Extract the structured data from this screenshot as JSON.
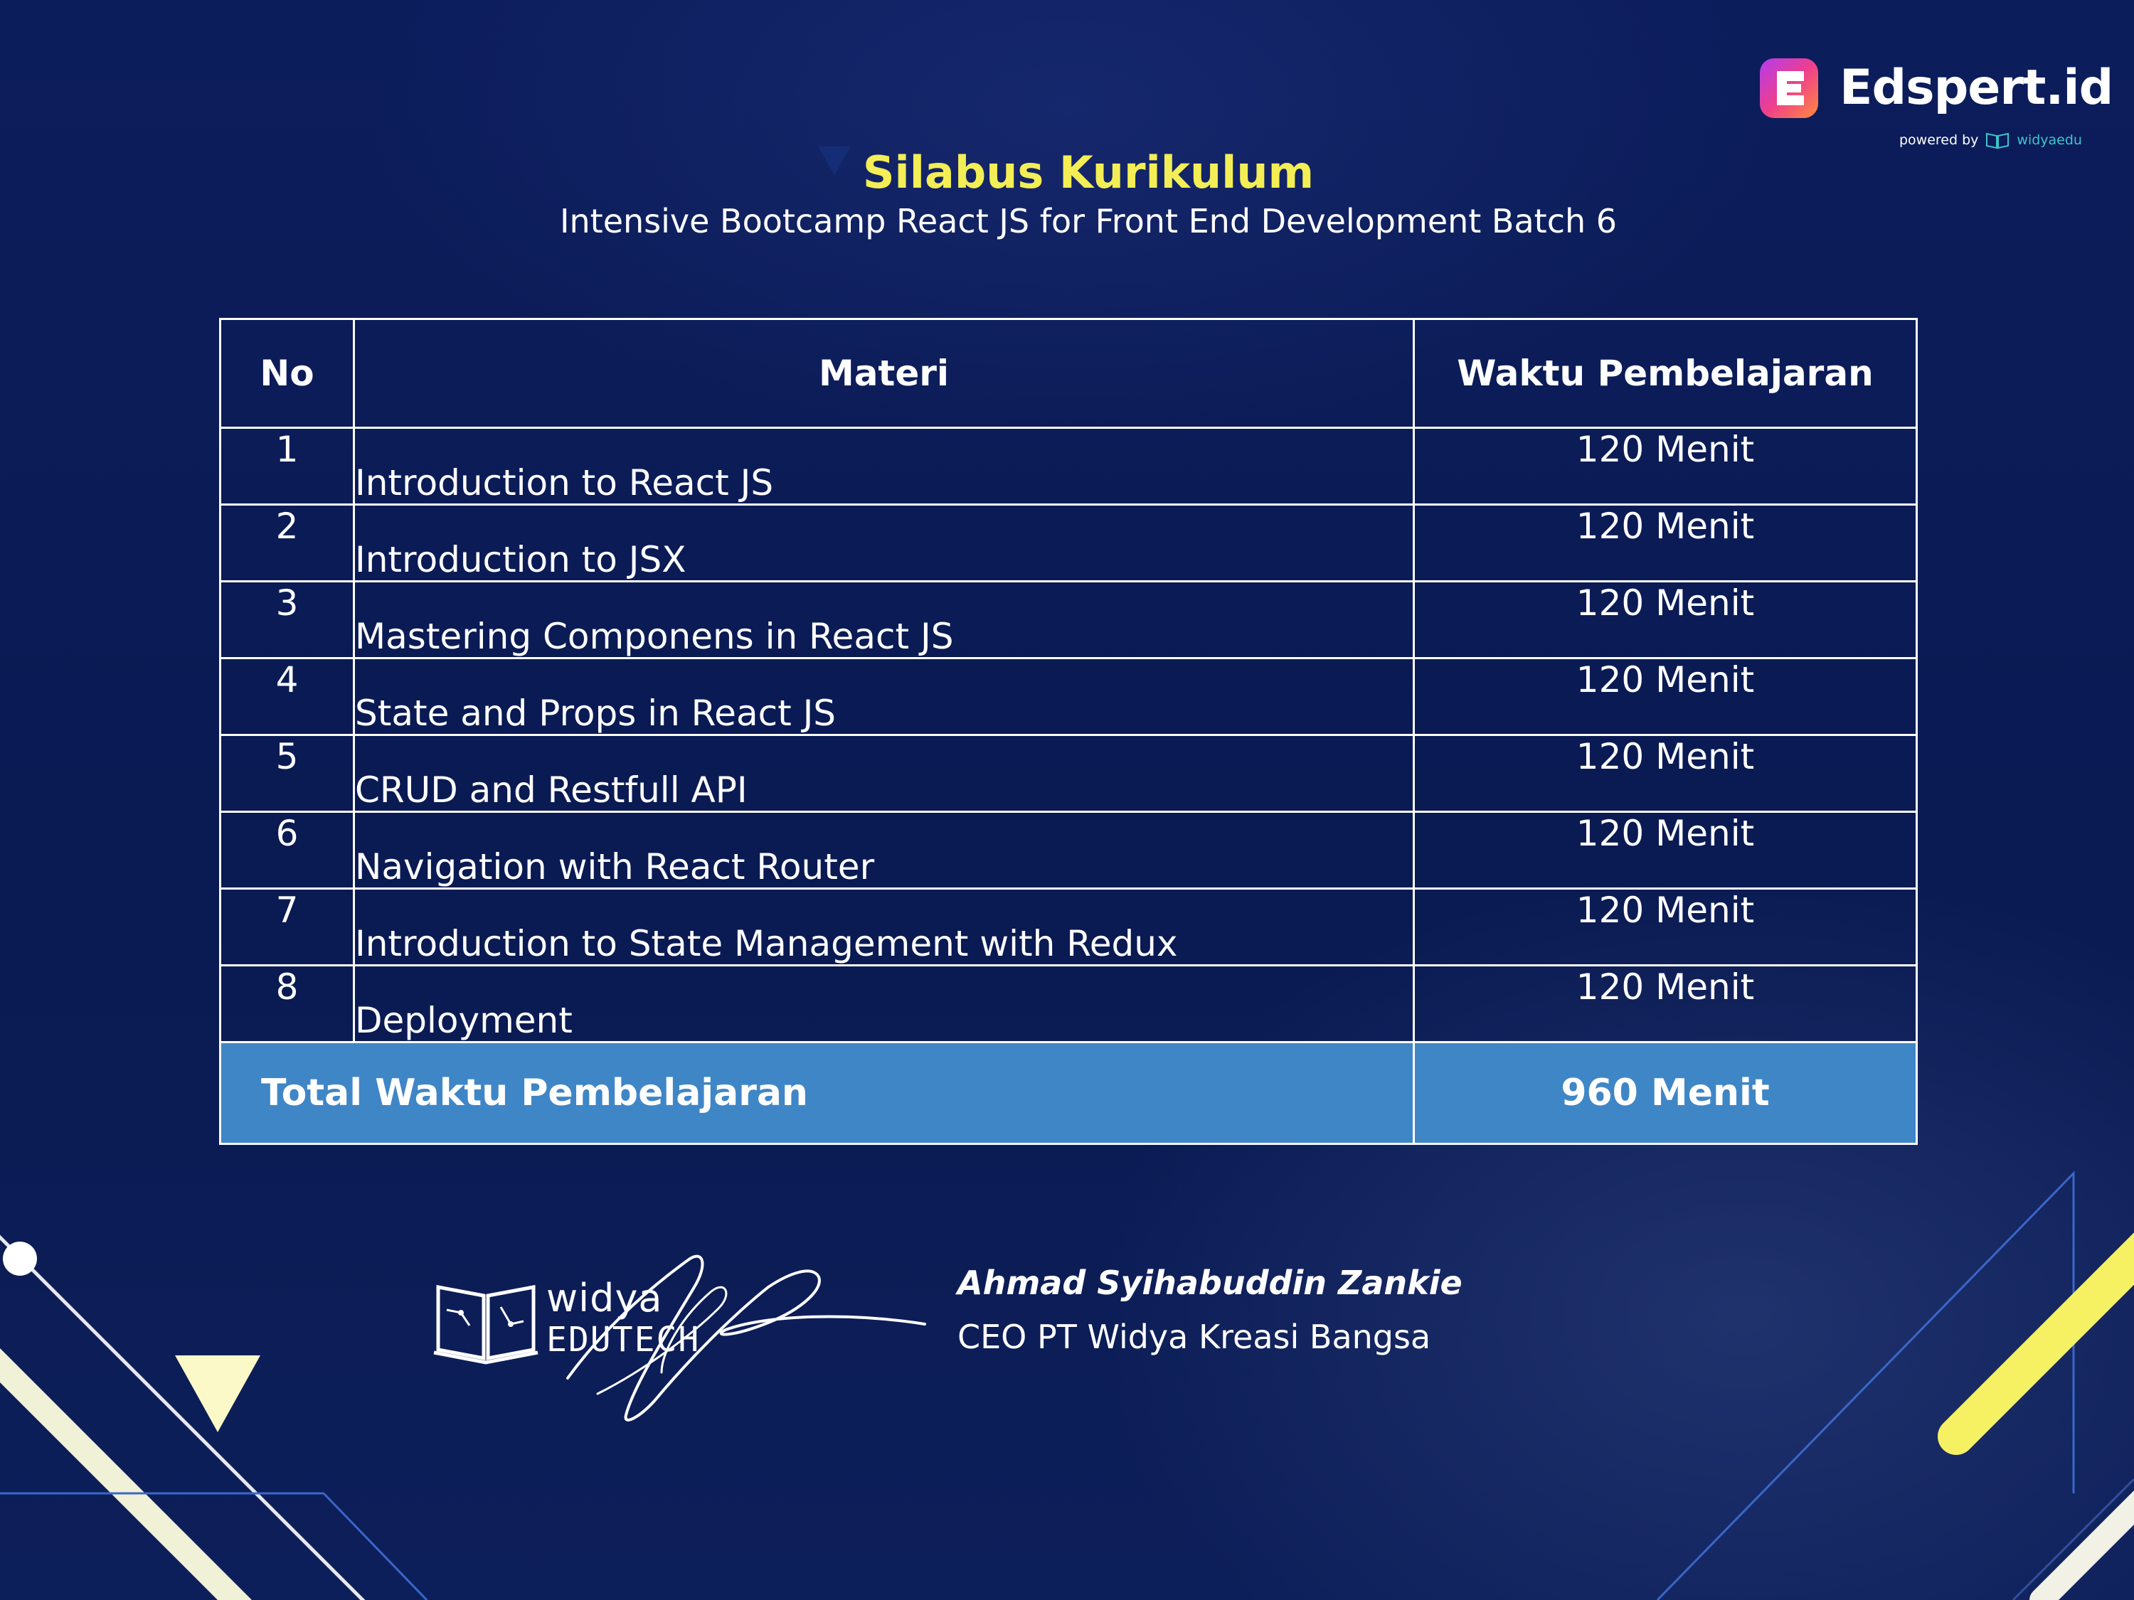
{
  "brand": {
    "name": "Edspert.id",
    "powered_by": "powered by",
    "partner": "widyaedu",
    "accent_yellow": "#f3ee55",
    "accent_blue": "#3f86c7",
    "background": "#0b1b58"
  },
  "header": {
    "title": "Silabus Kurikulum",
    "subtitle": "Intensive Bootcamp React JS for Front End Development Batch 6"
  },
  "table": {
    "columns": [
      "No",
      "Materi",
      "Waktu Pembelajaran"
    ],
    "rows": [
      {
        "no": "1",
        "materi": "Introduction to React JS",
        "waktu": "120 Menit"
      },
      {
        "no": "2",
        "materi": "Introduction to JSX",
        "waktu": "120 Menit"
      },
      {
        "no": "3",
        "materi": "Mastering Componens in React JS",
        "waktu": "120 Menit"
      },
      {
        "no": "4",
        "materi": "State and Props in React JS",
        "waktu": "120 Menit"
      },
      {
        "no": "5",
        "materi": "CRUD and Restfull API",
        "waktu": "120 Menit"
      },
      {
        "no": "6",
        "materi": "Navigation with React Router",
        "waktu": "120 Menit"
      },
      {
        "no": "7",
        "materi": "Introduction to State Management with Redux",
        "waktu": "120 Menit"
      },
      {
        "no": "8",
        "materi": "Deployment",
        "waktu": "120 Menit"
      }
    ],
    "total_label": "Total Waktu Pembelajaran",
    "total_value": "960 Menit"
  },
  "footer": {
    "org_logo_line1": "widya",
    "org_logo_line2": "EDUTECH",
    "signer_name": "Ahmad Syihabuddin Zankie",
    "signer_role": "CEO PT Widya Kreasi Bangsa"
  }
}
